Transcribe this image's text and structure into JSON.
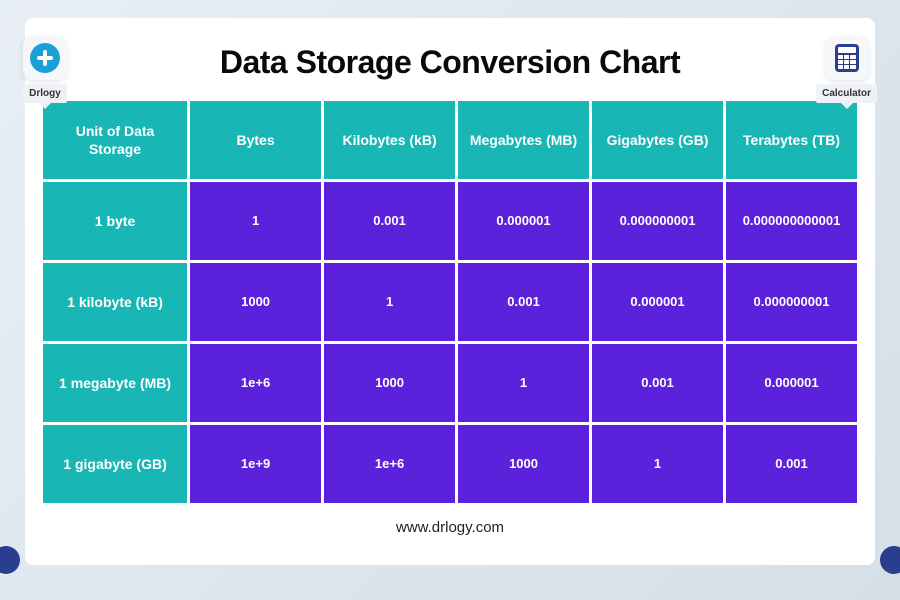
{
  "badges": {
    "left_label": "Drlogy",
    "right_label": "Calculator"
  },
  "title": "Data Storage Conversion Chart",
  "footer": "www.drlogy.com",
  "chart_data": {
    "type": "table",
    "columns": [
      "Unit of Data Storage",
      "Bytes",
      "Kilobytes (kB)",
      "Megabytes (MB)",
      "Gigabytes (GB)",
      "Terabytes (TB)"
    ],
    "rows": [
      {
        "label": "1 byte",
        "values": [
          "1",
          "0.001",
          "0.000001",
          "0.000000001",
          "0.000000000001"
        ]
      },
      {
        "label": "1 kilobyte (kB)",
        "values": [
          "1000",
          "1",
          "0.001",
          "0.000001",
          "0.000000001"
        ]
      },
      {
        "label": "1 megabyte (MB)",
        "values": [
          "1e+6",
          "1000",
          "1",
          "0.001",
          "0.000001"
        ]
      },
      {
        "label": "1 gigabyte (GB)",
        "values": [
          "1e+9",
          "1e+6",
          "1000",
          "1",
          "0.001"
        ]
      }
    ]
  }
}
